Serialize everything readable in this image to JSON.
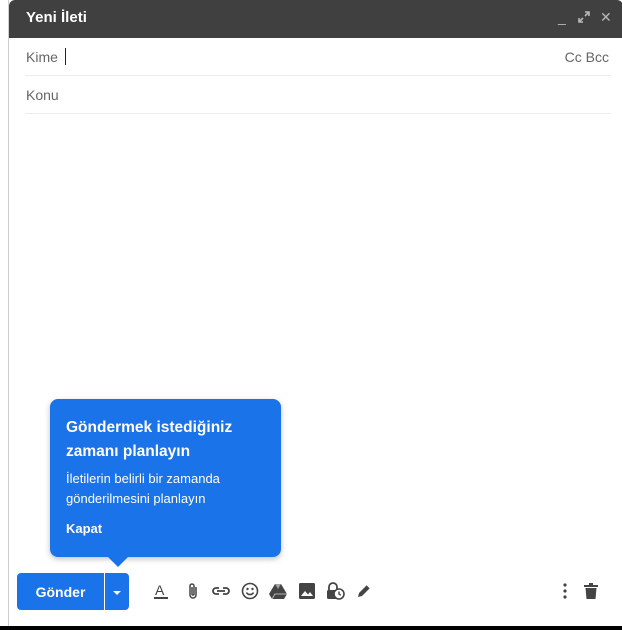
{
  "window": {
    "title": "Yeni İleti"
  },
  "fields": {
    "to_label": "Kime",
    "cc_bcc": "Cc Bcc",
    "subject_placeholder": "Konu"
  },
  "tooltip": {
    "title": "Göndermek istediğiniz zamanı planlayın",
    "description": "İletilerin belirli bir zamanda gönderilmesini planlayın",
    "close": "Kapat"
  },
  "toolbar": {
    "send_label": "Gönder",
    "icons": [
      "more-send-options-icon",
      "formatting-icon",
      "attach-icon",
      "link-icon",
      "emoji-icon",
      "drive-icon",
      "photo-icon",
      "confidential-mode-icon",
      "signature-icon",
      "more-options-icon",
      "trash-icon"
    ]
  },
  "colors": {
    "accent": "#1a73e8",
    "titlebar": "#404040"
  }
}
